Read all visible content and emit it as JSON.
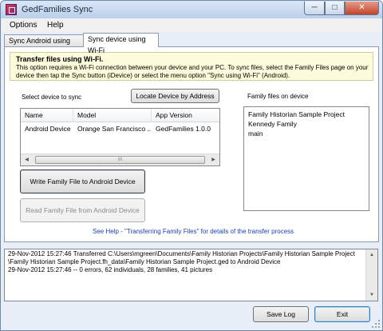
{
  "window": {
    "title": "GedFamilies Sync"
  },
  "title_buttons": {
    "minimize": "─",
    "maximize": "□",
    "close": "✕"
  },
  "menu": {
    "options": "Options",
    "help": "Help"
  },
  "tabs": {
    "android_usb": "Sync Android using USB",
    "wifi": "Sync device using Wi-Fi"
  },
  "info": {
    "heading": "Transfer files using Wi-Fi.",
    "text": "This option requires a Wi-Fi connection between your device and your PC.  To sync files, select the Family Files page on your device then tap the Sync button (iDevice) or select the menu option \"Sync using Wi-Fi\" (Android)."
  },
  "device_section": {
    "label": "Select device to sync",
    "locate_button": "Locate Device by Address",
    "columns": {
      "name": "Name",
      "model": "Model",
      "version": "App Version"
    },
    "rows": [
      {
        "name": "Android Device",
        "model": "Orange San Francisco ...",
        "version": "GedFamilies 1.0.0"
      }
    ],
    "scroll": {
      "left": "◀",
      "right": "▶",
      "thumb": "III"
    }
  },
  "files_section": {
    "label": "Family files on device",
    "items": [
      "Family Historian Sample Project",
      "Kennedy Family",
      "main"
    ]
  },
  "buttons": {
    "write": "Write Family File to Android Device",
    "read": "Read Family File from Android Device",
    "save_log": "Save Log",
    "exit": "Exit"
  },
  "help_link": "See Help - \"Transferring Family Files\" for details of the transfer process",
  "log": {
    "line1": "29-Nov-2012 15:27:46 Transferred C:\\Users\\mgreen\\Documents\\Family Historian Projects\\Family Historian Sample Project",
    "line2": "\\Family Historian Sample Project.fh_data\\Family Historian Sample Project.ged to Android Device",
    "line3": "29-Nov-2012 15:27:46 -- 0 errors, 62 individuals, 28 families, 41 pictures",
    "scroll_up": "▲",
    "scroll_down": "▼"
  }
}
